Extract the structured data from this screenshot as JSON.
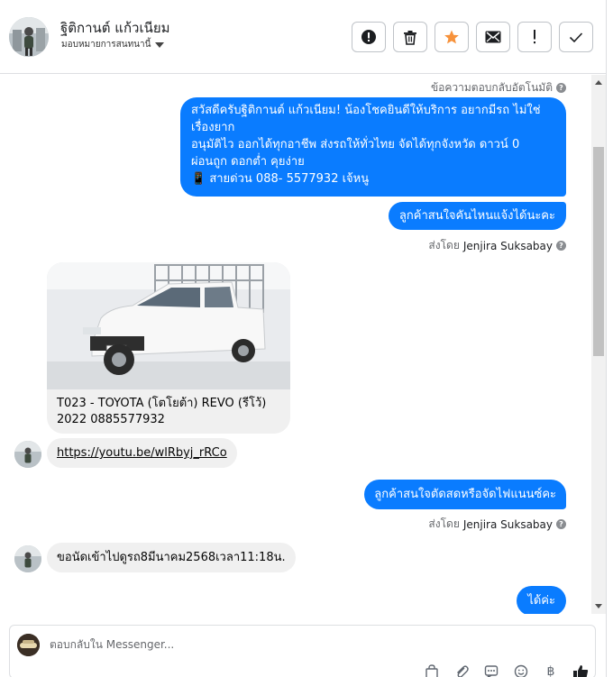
{
  "header": {
    "customer_name": "ฐิติกานต์ แก้วเนียม",
    "assign_label": "มอบหมายการสนทนานี้"
  },
  "toolbar": {
    "buttons": [
      {
        "name": "report-icon",
        "label": "Report"
      },
      {
        "name": "trash-icon",
        "label": "Delete"
      },
      {
        "name": "star-icon",
        "label": "Star"
      },
      {
        "name": "mail-icon",
        "label": "Mark unread"
      },
      {
        "name": "exclamation-icon",
        "label": "Follow up"
      },
      {
        "name": "check-icon",
        "label": "Done"
      }
    ],
    "star_color": "#f7923b"
  },
  "thread": {
    "auto_reply_label": "ข้อความตอบกลับอัตโนมัติ",
    "welcome_lines": [
      "สวัสดีครับฐิติกานต์ แก้วเนียม! น้องโชคยินดีให้บริการ อยากมีรถ ไม่ใช่",
      "เรื่องยาก",
      "อนุมัติไว ออกได้ทุกอาชีพ ส่งรถให้ทั่วไทย จัดได้ทุกจังหวัด ดาวน์ 0",
      "ผ่อนถูก ดอกต่ำ คุยง่าย",
      "📱 สายด่วน 088- 5577932 เจ้หนู"
    ],
    "agent_msg_1": "ลูกค้าสนใจคันไหนแจ้งได้นะคะ",
    "sent_by_prefix": "ส่งโดย",
    "agent_name": "Jenjira Suksabay",
    "car_card_line1": "T023 - TOYOTA (โตโยต้า) REVO (รีโว้)",
    "car_card_line2": "2022 0885577932",
    "customer_link": "https://youtu.be/wlRbyj_rRCo",
    "agent_msg_2": "ลูกค้าสนใจตัดสดหรือจัดไฟแนนซ์คะ",
    "customer_msg_2": "ขอนัดเข้าไปดูรถ8มีนาคม2568เวลา11:18น.",
    "agent_msg_3": "ได้ค่ะ"
  },
  "composer": {
    "placeholder": "ตอบกลับใน Messenger...",
    "tools": [
      "bag-icon",
      "paperclip-icon",
      "chat-icon",
      "emoji-icon",
      "baht-icon",
      "thumbs-up-icon"
    ]
  },
  "colors": {
    "outgoing_bubble": "#0a7cff",
    "incoming_bubble": "#f0f0f0"
  }
}
